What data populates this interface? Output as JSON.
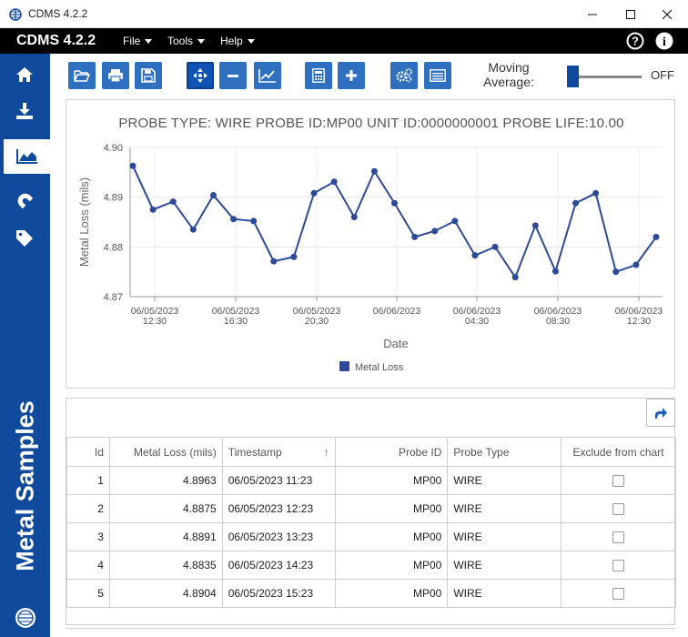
{
  "window": {
    "title": "CDMS 4.2.2"
  },
  "menubar": {
    "brand": "CDMS 4.2.2",
    "menus": [
      {
        "label": "File"
      },
      {
        "label": "Tools"
      },
      {
        "label": "Help"
      }
    ]
  },
  "sidebar": {
    "title": "Metal Samples",
    "items": [
      {
        "icon": "home-icon"
      },
      {
        "icon": "download-icon"
      },
      {
        "icon": "chart-icon",
        "active": true
      },
      {
        "icon": "magnet-icon"
      },
      {
        "icon": "tag-icon"
      }
    ]
  },
  "toolbar": {
    "moving_average_label": "Moving Average:",
    "moving_average_state": "OFF",
    "buttons": [
      "open-folder",
      "print",
      "save",
      "pan",
      "zoom-out",
      "trend",
      "calculator",
      "add",
      "settings",
      "list"
    ]
  },
  "chart_title": "PROBE TYPE: WIRE  PROBE ID:MP00  UNIT ID:0000000001  PROBE LIFE:10.00",
  "chart_data": {
    "type": "line",
    "title": "PROBE TYPE: WIRE  PROBE ID:MP00  UNIT ID:0000000001  PROBE LIFE:10.00",
    "xlabel": "Date",
    "ylabel": "Metal Loss (mils)",
    "ylim": [
      4.87,
      4.9
    ],
    "yticks": [
      "4.87",
      "4.88",
      "4.89",
      "4.90"
    ],
    "xticks": [
      [
        "06/05/2023",
        "12:30"
      ],
      [
        "06/05/2023",
        "16:30"
      ],
      [
        "06/05/2023",
        "20:30"
      ],
      [
        "06/06/2023",
        ""
      ],
      [
        "06/06/2023",
        "04:30"
      ],
      [
        "06/06/2023",
        "08:30"
      ],
      [
        "06/06/2023",
        "12:30"
      ]
    ],
    "legend_position": "bottom",
    "series": [
      {
        "name": "Metal Loss",
        "color": "#2d4a9a",
        "values": [
          4.8963,
          4.8875,
          4.8891,
          4.8835,
          4.8904,
          4.8856,
          4.8852,
          4.8771,
          4.878,
          4.8908,
          4.8931,
          4.886,
          4.8952,
          4.8888,
          4.882,
          4.8832,
          4.8852,
          4.8783,
          4.88,
          4.8739,
          4.8843,
          4.8751,
          4.8888,
          4.8908,
          4.875,
          4.8764,
          4.882
        ]
      }
    ]
  },
  "table": {
    "columns": [
      "Id",
      "Metal Loss (mils)",
      "Timestamp",
      "Probe ID",
      "Probe Type",
      "Exclude from chart"
    ],
    "sort_indicator": "↑",
    "rows": [
      {
        "id": "1",
        "loss": "4.8963",
        "timestamp": "06/05/2023 11:23",
        "probe_id": "MP00",
        "probe_type": "WIRE"
      },
      {
        "id": "2",
        "loss": "4.8875",
        "timestamp": "06/05/2023 12:23",
        "probe_id": "MP00",
        "probe_type": "WIRE"
      },
      {
        "id": "3",
        "loss": "4.8891",
        "timestamp": "06/05/2023 13:23",
        "probe_id": "MP00",
        "probe_type": "WIRE"
      },
      {
        "id": "4",
        "loss": "4.8835",
        "timestamp": "06/05/2023 14:23",
        "probe_id": "MP00",
        "probe_type": "WIRE"
      },
      {
        "id": "5",
        "loss": "4.8904",
        "timestamp": "06/05/2023 15:23",
        "probe_id": "MP00",
        "probe_type": "WIRE"
      }
    ]
  }
}
